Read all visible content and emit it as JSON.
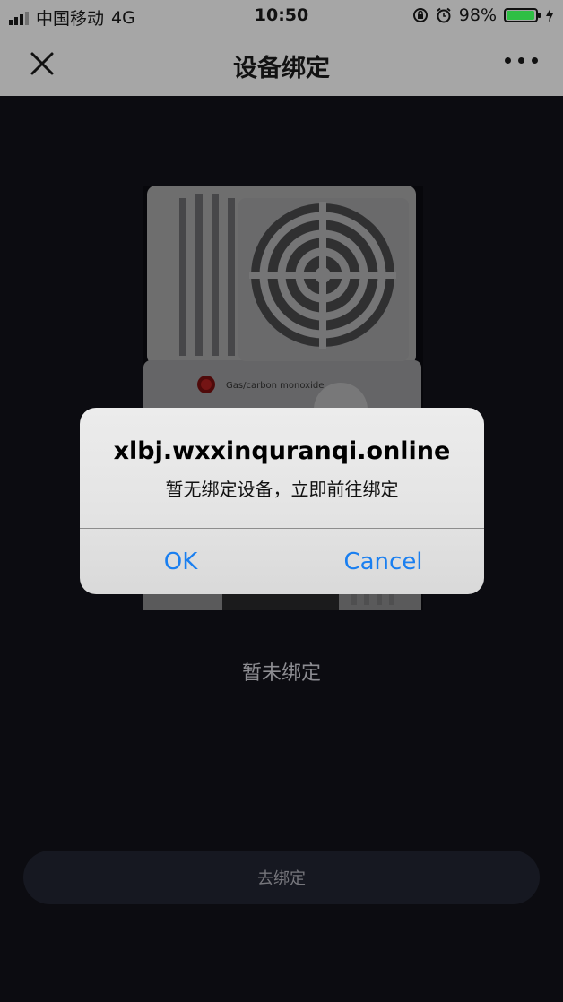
{
  "status_bar": {
    "carrier": "中国移动",
    "network": "4G",
    "time": "10:50",
    "battery": "98%",
    "battery_level": 0.98,
    "battery_color": "#2fbf44",
    "icons": [
      "signal-icon",
      "rotation-lock-icon",
      "alarm-icon",
      "battery-icon",
      "charging-icon"
    ]
  },
  "nav": {
    "title": "设备绑定",
    "close_icon": "close-icon",
    "more_icon": "more-icon"
  },
  "device": {
    "label": "Gas/carbon monoxide"
  },
  "main": {
    "status_text": "暂未绑定",
    "bind_button": "去绑定"
  },
  "alert": {
    "title": "xlbj.wxxinquranqi.online",
    "message": "暂无绑定设备，立即前往绑定",
    "ok": "OK",
    "cancel": "Cancel",
    "button_color": "#1a7ff0"
  }
}
